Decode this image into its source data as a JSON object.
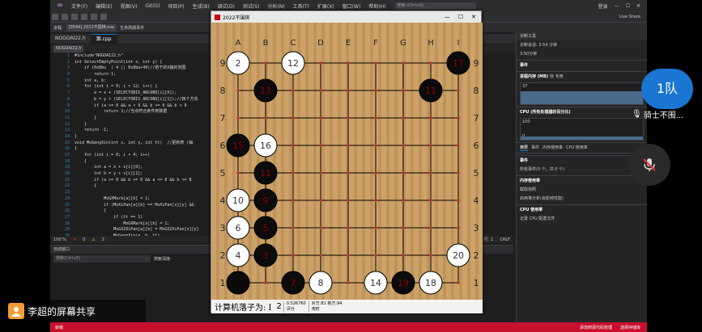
{
  "vs": {
    "menus": [
      "文件(F)",
      "编辑(E)",
      "视图(V)",
      "Git(G)",
      "项目(P)",
      "生成(B)",
      "调试(D)",
      "测试(S)",
      "分析(N)",
      "工具(T)",
      "扩展(X)",
      "窗口(W)",
      "帮助(H)"
    ],
    "search_placeholder": "搜索 (Ctrl+Q)",
    "login": "登录",
    "live_share": "Live Share",
    "process_label": "进程:",
    "process_value": "[9544] 2022不围棋.exe",
    "lifecycle_label": "生命周期事件",
    "tabs": [
      {
        "label": "NOGOAI22.h"
      },
      {
        "label": "源.cpp"
      }
    ],
    "nav_scope": "NOGOAI22.h",
    "code_lines": [
      {
        "n": "1",
        "t": "#include\"NOGOAI22.h\""
      },
      {
        "n": "2",
        "t": "int SelectEmptyPoint(int x, int y) {"
      },
      {
        "n": "3",
        "t": "    if (0x8bu  ( 4 || 0x8bu>40)//若干的X轴的范围"
      },
      {
        "n": "4",
        "t": "        return 1;"
      },
      {
        "n": "5",
        "t": "    int a, b;"
      },
      {
        "n": "6",
        "t": "    for (int i = 0; i < 12; i++) {"
      },
      {
        "n": "7",
        "t": "        a = x + (SELECTOBIS_ARCOBO[i][0]);"
      },
      {
        "n": "8",
        "t": "        b = y + (SELECTOBIS_ARCOBO[i][1]);//四个方向"
      },
      {
        "n": "9",
        "t": "        if (a >= 0 && a < 9 && b >= 0 && b < 9"
      },
      {
        "n": "10",
        "t": "            return 1;//当点符合条件到数据"
      },
      {
        "n": "11",
        "t": "        }"
      },
      {
        "n": "12",
        "t": "    }"
      },
      {
        "n": "13",
        "t": "    return -1;"
      },
      {
        "n": "14",
        "t": "}"
      },
      {
        "n": "15",
        "t": "void MoGengXin(int x, int y, int tt)  //更新表 (每"
      },
      {
        "n": "16",
        "t": "{"
      },
      {
        "n": "17",
        "t": "    for (int i = 0; i < 4; i++)"
      },
      {
        "n": "18",
        "t": "    {"
      },
      {
        "n": "19",
        "t": "        int a = x + v[i][0];"
      },
      {
        "n": "20",
        "t": "        int b = y + v[i][1];"
      },
      {
        "n": "21",
        "t": "        if (a >= 0 && b >= 0 && a <= 8 && b <= 8"
      },
      {
        "n": "22",
        "t": "        {"
      },
      {
        "n": "23",
        "t": ""
      },
      {
        "n": "24",
        "t": "            MoGXMark[a][b] = 1;"
      },
      {
        "n": "25",
        "t": "            if (MoXiPan[a][b] == MoXiPan[x][y] &&"
      },
      {
        "n": "26",
        "t": "            {"
      },
      {
        "n": "27",
        "t": "                if (tt == 1)"
      },
      {
        "n": "28",
        "t": "                    MoGXMark[a][b] = 1;"
      },
      {
        "n": "29",
        "t": "                MoGX2XiPan[a][b] = MoGX2XiPan[x][y]"
      },
      {
        "n": "30",
        "t": "                MoGengXin(a, b, tt)"
      }
    ],
    "zoom": "100 %",
    "errors": "0",
    "warnings": "2",
    "line_info": "行: 1",
    "crlf": "CRLF",
    "output_pane_title": "自动窗口",
    "output_search": "搜索(Ctrl+E)",
    "search_depth": "搜索深度:",
    "statusbar_text": "就绪",
    "statusbar_right1": "添加到源代码管理",
    "statusbar_right2": "选择存储库"
  },
  "diag": {
    "title": "诊断工具",
    "session": "诊断会话: 3:54 分钟",
    "time_mark": "3:50分钟",
    "events_header": "事件",
    "memory_header": "进程内存 (MB)",
    "memory_legend1": "快",
    "memory_legend2": "专用",
    "mem_max": "37",
    "mem_min": "0",
    "cpu_header": "CPU (所有处理器的百分比)",
    "cpu_max": "100",
    "cpu_min": "0",
    "tabs": [
      "摘要",
      "事件",
      "内存使用率",
      "CPU 使用率"
    ],
    "section_events": "事件",
    "all_events": "所有事件(0 个，共 0 个)",
    "section_memory": "内存使用率",
    "snapshot": "截取快照",
    "heap_profiling": "启用堆分析(会影响性能)",
    "section_cpu": "CPU 使用率",
    "record_cpu": "记录 CPU 配置文件"
  },
  "game": {
    "title": "2022不围棋",
    "columns": [
      "A",
      "B",
      "C",
      "D",
      "E",
      "F",
      "G",
      "H",
      "I"
    ],
    "rows": [
      "9",
      "8",
      "7",
      "6",
      "5",
      "4",
      "3",
      "2",
      "1"
    ],
    "stones": [
      {
        "col": 0,
        "row": 8,
        "color": "white",
        "label": "2"
      },
      {
        "col": 2,
        "row": 8,
        "color": "white",
        "label": "12"
      },
      {
        "col": 8,
        "row": 8,
        "color": "black",
        "label": "17"
      },
      {
        "col": 1,
        "row": 7,
        "color": "black",
        "label": "13"
      },
      {
        "col": 7,
        "row": 7,
        "color": "black",
        "label": "11"
      },
      {
        "col": 0,
        "row": 5,
        "color": "black",
        "label": "15"
      },
      {
        "col": 1,
        "row": 5,
        "color": "white",
        "label": "16"
      },
      {
        "col": 1,
        "row": 4,
        "color": "black",
        "label": "11"
      },
      {
        "col": 0,
        "row": 3,
        "color": "white",
        "label": "10"
      },
      {
        "col": 1,
        "row": 3,
        "color": "black",
        "label": "9"
      },
      {
        "col": 0,
        "row": 2,
        "color": "white",
        "label": "6"
      },
      {
        "col": 1,
        "row": 2,
        "color": "black",
        "label": "5"
      },
      {
        "col": 0,
        "row": 1,
        "color": "white",
        "label": "4"
      },
      {
        "col": 1,
        "row": 1,
        "color": "black",
        "label": "3"
      },
      {
        "col": 8,
        "row": 1,
        "color": "white",
        "label": "20"
      },
      {
        "col": 0,
        "row": 0,
        "color": "black",
        "label": ""
      },
      {
        "col": 2,
        "row": 0,
        "color": "black",
        "label": "7"
      },
      {
        "col": 3,
        "row": 0,
        "color": "white",
        "label": "8"
      },
      {
        "col": 5,
        "row": 0,
        "color": "white",
        "label": "14"
      },
      {
        "col": 6,
        "row": 0,
        "color": "black",
        "label": "19"
      },
      {
        "col": 7,
        "row": 0,
        "color": "white",
        "label": "18"
      }
    ],
    "status_prefix": "计算机落子为: I",
    "status_move": "2",
    "eval_value": "0.526760",
    "eval_label": "评分",
    "opp_label": "对方:",
    "opp_value": "81",
    "self_label": "我方:",
    "self_value": "94",
    "time_label": "用时"
  },
  "meeting": {
    "team": "1队",
    "member": "骑士不围...",
    "sharer": "李超的屏幕共享"
  }
}
